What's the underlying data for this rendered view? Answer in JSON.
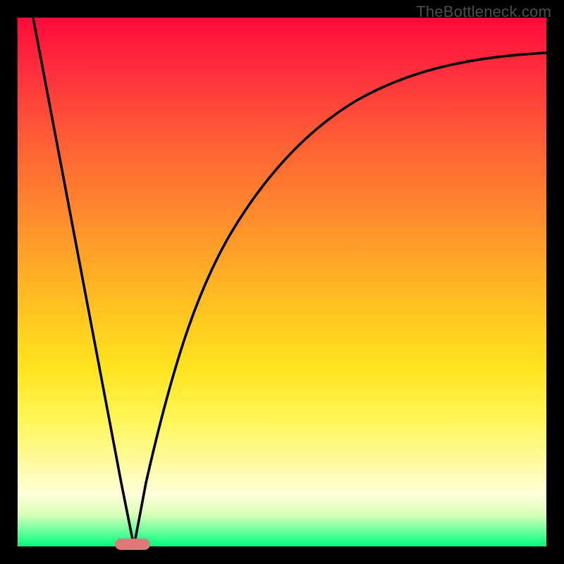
{
  "watermark": "TheBottleneck.com",
  "colors": {
    "background": "#000000",
    "curve": "#000000",
    "marker": "#e07878",
    "watermark": "#4d4d4d",
    "gradient_top": "#ff0a3a",
    "gradient_bottom": "#00ff7f"
  },
  "chart_data": {
    "type": "line",
    "title": "",
    "xlabel": "",
    "ylabel": "",
    "xlim": [
      0,
      100
    ],
    "ylim": [
      0,
      100
    ],
    "grid": false,
    "legend": false,
    "series": [
      {
        "name": "curve",
        "x": [
          3,
          6,
          10,
          14,
          17,
          19,
          22,
          26,
          30,
          34,
          38,
          42,
          46,
          50,
          55,
          60,
          65,
          70,
          75,
          80,
          85,
          90,
          95,
          100
        ],
        "y": [
          100,
          84,
          63,
          42,
          26,
          13,
          0,
          22,
          38,
          50,
          59,
          66,
          72,
          76,
          80,
          83,
          85.5,
          87.5,
          89,
          90.2,
          91.2,
          92,
          92.7,
          93.3
        ]
      }
    ],
    "minimum_marker": {
      "x": 22,
      "y": 0,
      "width": 6
    }
  }
}
